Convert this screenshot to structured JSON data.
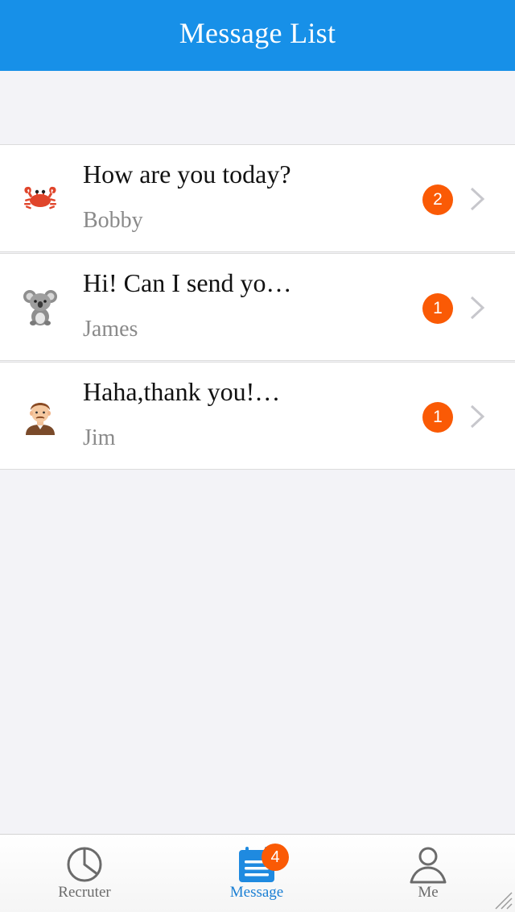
{
  "header": {
    "title": "Message List"
  },
  "messages": [
    {
      "text": "How are you today?",
      "sender": "Bobby",
      "unread": "2",
      "avatar_icon": "crab-icon"
    },
    {
      "text": "Hi! Can I send yo…",
      "sender": "James",
      "unread": "1",
      "avatar_icon": "koala-icon"
    },
    {
      "text": "Haha,thank you!…",
      "sender": "Jim",
      "unread": "1",
      "avatar_icon": "man-face-icon"
    }
  ],
  "tabbar": {
    "tabs": [
      {
        "label": "Recruter",
        "icon": "pie-chart-icon",
        "active": false
      },
      {
        "label": "Message",
        "icon": "calendar-list-icon",
        "active": true,
        "badge": "4"
      },
      {
        "label": "Me",
        "icon": "user-profile-icon",
        "active": false
      }
    ]
  },
  "colors": {
    "header_bg": "#1790e8",
    "badge_bg": "#fa5a05",
    "active_tab": "#1a7fd4",
    "page_bg": "#f3f3f7"
  }
}
